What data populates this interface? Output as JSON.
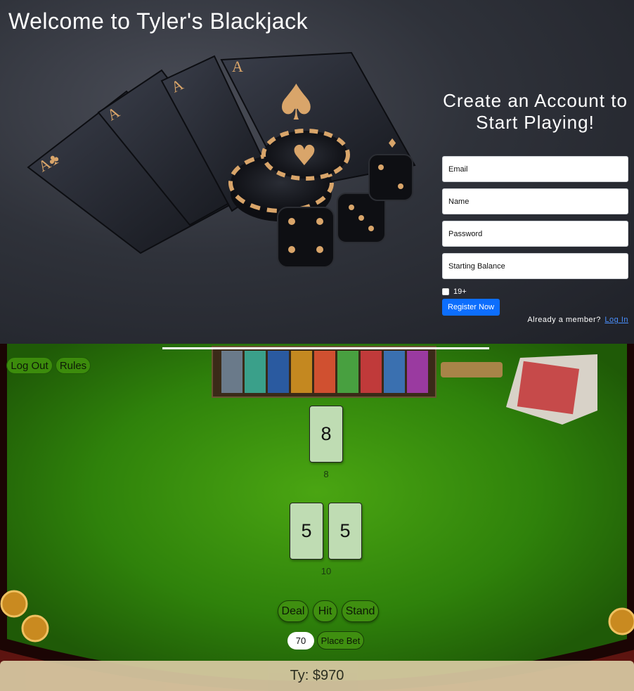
{
  "hero": {
    "title": "Welcome to Tyler's Blackjack",
    "signup": {
      "heading_line1": "Create an Account to",
      "heading_line2": "Start Playing!",
      "email_placeholder": "Email",
      "name_placeholder": "Name",
      "password_placeholder": "Password",
      "balance_placeholder": "Starting Balance",
      "age_label": "19+",
      "register_label": "Register Now",
      "member_text": "Already a member?",
      "login_link": "Log In"
    },
    "art": {
      "card_rank": "A",
      "suits": [
        "clubs-icon",
        "spades-icon",
        "hearts-icon",
        "diamonds-icon"
      ],
      "accent": "#d9a56a"
    }
  },
  "game": {
    "logout_label": "Log Out",
    "rules_label": "Rules",
    "dealer_cards": [
      "8"
    ],
    "dealer_score": "8",
    "player_cards": [
      "5",
      "5"
    ],
    "player_score": "10",
    "deal_label": "Deal",
    "hit_label": "Hit",
    "stand_label": "Stand",
    "bet_value": "70",
    "place_bet_label": "Place Bet",
    "balance_text": "Ty: $970",
    "colors": {
      "felt": "#3f8f10",
      "card": "#bfdcb3",
      "register_button": "#0d6efd"
    }
  }
}
